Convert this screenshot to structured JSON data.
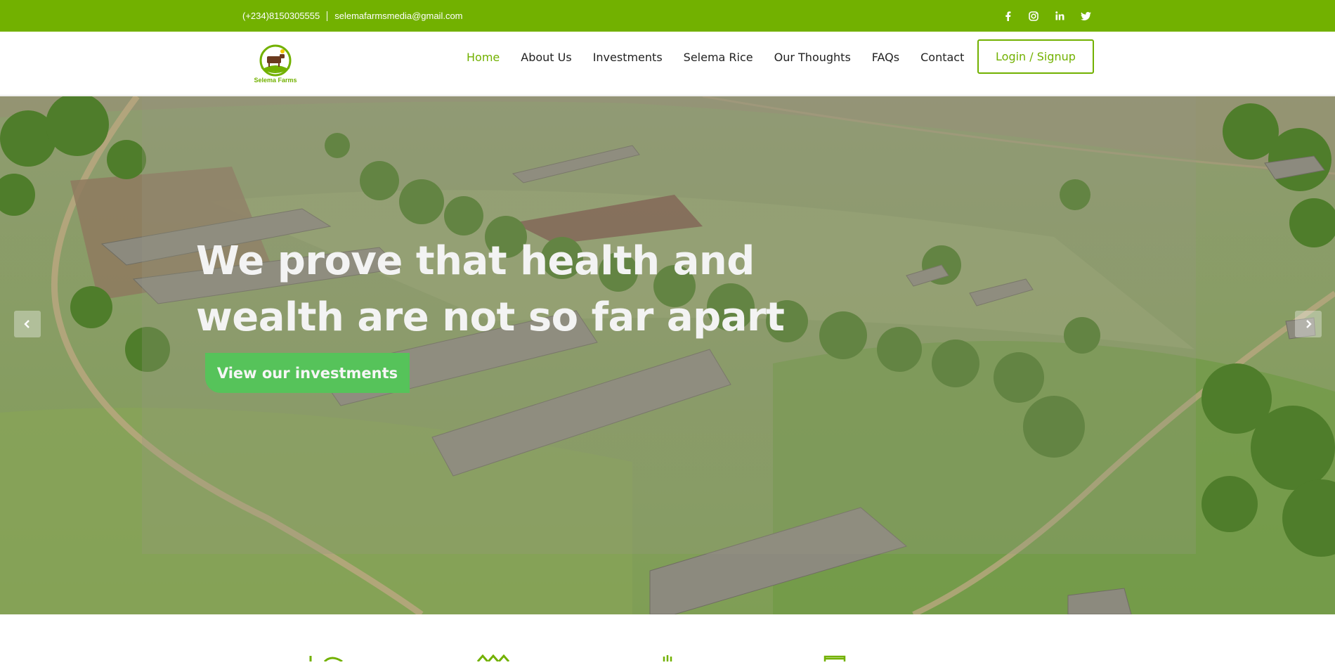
{
  "topbar": {
    "phone": "(+234)8150305555",
    "email": "selemafarmsmedia@gmail.com",
    "background_color": "#72b100",
    "social": [
      "facebook-icon",
      "instagram-icon",
      "linkedin-icon",
      "twitter-icon"
    ]
  },
  "header": {
    "logo_text": "Selema Farms",
    "nav": [
      {
        "label": "Home",
        "active": true
      },
      {
        "label": "About Us"
      },
      {
        "label": "Investments"
      },
      {
        "label": "Selema Rice"
      },
      {
        "label": "Our Thoughts"
      },
      {
        "label": "FAQs"
      },
      {
        "label": "Contact"
      }
    ],
    "login_label": "Login / Signup",
    "accent_color": "#72b100"
  },
  "hero": {
    "headline_line1": "We prove that health and",
    "headline_line2": "wealth are not so far apart",
    "cta_label": "View our investments",
    "cta_color": "#56c35a",
    "prev_icon": "chevron-left-icon",
    "next_icon": "chevron-right-icon"
  },
  "features": {
    "icons": [
      "leaf-icon",
      "crop-icon",
      "sun-icon",
      "chart-icon"
    ]
  }
}
